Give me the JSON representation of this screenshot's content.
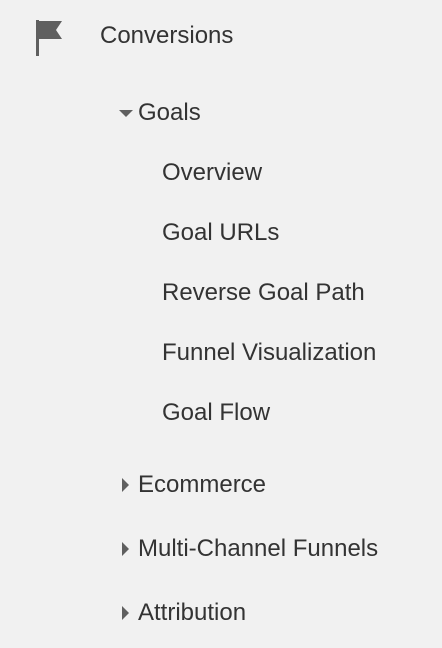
{
  "section": {
    "label": "Conversions",
    "icon": "flag-icon"
  },
  "goals": {
    "label": "Goals",
    "expanded": true,
    "items": [
      {
        "label": "Overview"
      },
      {
        "label": "Goal URLs"
      },
      {
        "label": "Reverse Goal Path"
      },
      {
        "label": "Funnel Visualization"
      },
      {
        "label": "Goal Flow"
      }
    ]
  },
  "groups": [
    {
      "label": "Ecommerce",
      "expanded": false
    },
    {
      "label": "Multi-Channel Funnels",
      "expanded": false
    },
    {
      "label": "Attribution",
      "expanded": false
    }
  ],
  "colors": {
    "background": "#f1f1f1",
    "text": "#333333",
    "icon": "#5f5f5f"
  }
}
